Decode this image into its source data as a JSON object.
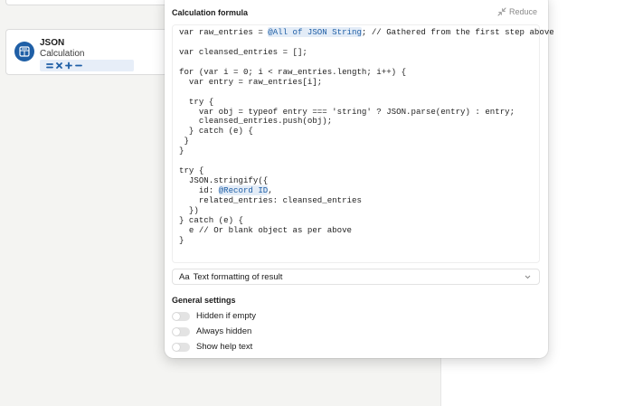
{
  "canvas": {
    "node": {
      "title": "JSON",
      "subtitle": "Calculation",
      "operators": [
        "=",
        "×",
        "+",
        "−"
      ]
    }
  },
  "dialog": {
    "section_title": "Calculation formula",
    "reduce_label": "Reduce",
    "code_lines": [
      [
        {
          "t": "var raw_entries = "
        },
        {
          "t": "@All of JSON String",
          "mention": true
        },
        {
          "t": "; // Gathered from the first step above"
        }
      ],
      [
        {
          "t": ""
        }
      ],
      [
        {
          "t": "var cleansed_entries = [];"
        }
      ],
      [
        {
          "t": ""
        }
      ],
      [
        {
          "t": "for (var i = 0; i < raw_entries.length; i++) {"
        }
      ],
      [
        {
          "t": "  var entry = raw_entries[i];"
        }
      ],
      [
        {
          "t": ""
        }
      ],
      [
        {
          "t": "  try {"
        }
      ],
      [
        {
          "t": "    var obj = typeof entry === 'string' ? JSON.parse(entry) : entry;"
        }
      ],
      [
        {
          "t": "    cleansed_entries.push(obj);"
        }
      ],
      [
        {
          "t": "  } catch (e) {"
        }
      ],
      [
        {
          "t": " }"
        }
      ],
      [
        {
          "t": "}"
        }
      ],
      [
        {
          "t": ""
        }
      ],
      [
        {
          "t": "try {"
        }
      ],
      [
        {
          "t": "  JSON.stringify({"
        }
      ],
      [
        {
          "t": "    id: "
        },
        {
          "t": "@Record ID",
          "mention": true
        },
        {
          "t": ","
        }
      ],
      [
        {
          "t": "    related_entries: cleansed_entries"
        }
      ],
      [
        {
          "t": "  })"
        }
      ],
      [
        {
          "t": "} catch (e) {"
        }
      ],
      [
        {
          "t": "  e // Or blank object as per above"
        }
      ],
      [
        {
          "t": "}"
        }
      ]
    ],
    "format_select": {
      "prefix": "Aa",
      "label": "Text formatting of result"
    },
    "general_settings_title": "General settings",
    "toggles": [
      {
        "label": "Hidden if empty",
        "on": false
      },
      {
        "label": "Always hidden",
        "on": false
      },
      {
        "label": "Show help text",
        "on": false
      }
    ]
  },
  "colors": {
    "accent": "#1f5fa6",
    "mention_bg": "#e3ecf7"
  }
}
